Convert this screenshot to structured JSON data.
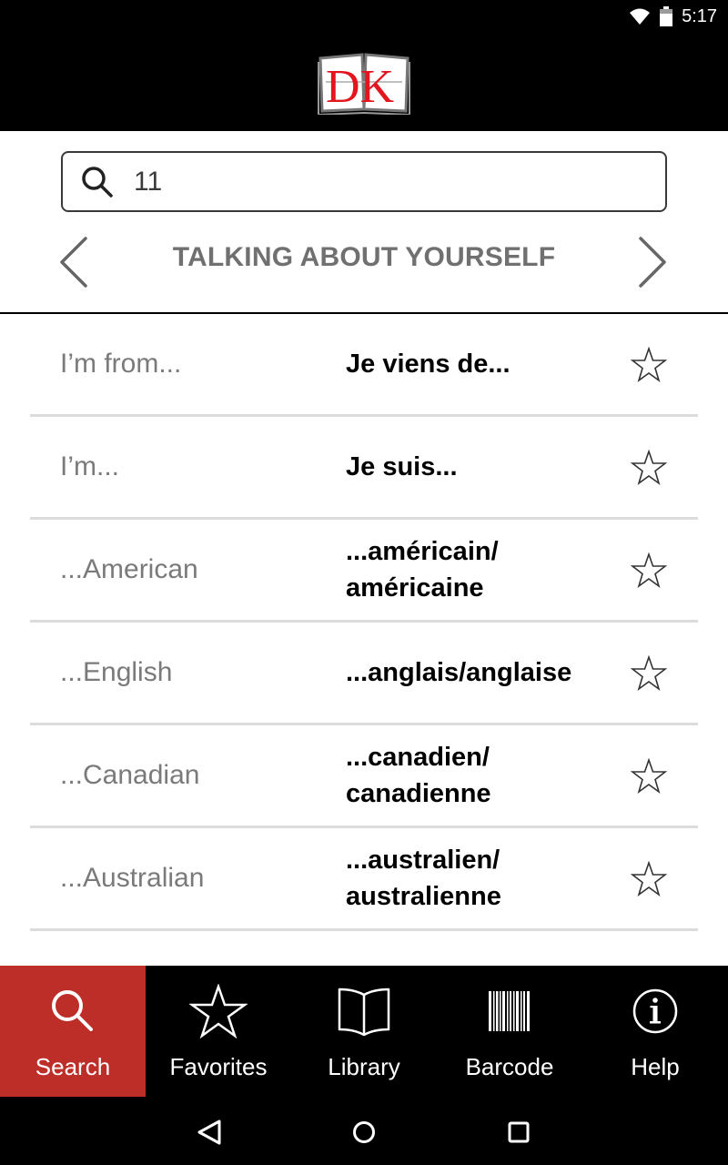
{
  "status_bar": {
    "time": "5:17",
    "icons": [
      "wifi-icon",
      "battery-icon"
    ]
  },
  "header": {
    "logo_text": "DK",
    "logo_colors": {
      "letters": "#e3161f",
      "book": "#ffffff",
      "outline": "#555555"
    }
  },
  "search": {
    "value": "11",
    "icon": "search-icon"
  },
  "category": {
    "title": "TALKING ABOUT YOURSELF",
    "prev_icon": "chevron-left-icon",
    "next_icon": "chevron-right-icon"
  },
  "phrases": [
    {
      "english": "I’m from...",
      "french": "Je viens de...",
      "favorite": false
    },
    {
      "english": "I’m...",
      "french": "Je suis...",
      "favorite": false
    },
    {
      "english": "...American",
      "french": "...américain/ américaine",
      "favorite": false
    },
    {
      "english": "...English",
      "french": "...anglais/anglaise",
      "favorite": false
    },
    {
      "english": "...Canadian",
      "french": "...canadien/ canadienne",
      "favorite": false
    },
    {
      "english": "...Australian",
      "french": "...australien/ australienne",
      "favorite": false
    }
  ],
  "bottom_nav": {
    "active_color": "#be2e29",
    "items": [
      {
        "label": "Search",
        "icon": "search-icon",
        "active": true
      },
      {
        "label": "Favorites",
        "icon": "star-icon",
        "active": false
      },
      {
        "label": "Library",
        "icon": "book-icon",
        "active": false
      },
      {
        "label": "Barcode",
        "icon": "barcode-icon",
        "active": false
      },
      {
        "label": "Help",
        "icon": "info-icon",
        "active": false
      }
    ]
  },
  "system_nav": {
    "buttons": [
      "back-icon",
      "home-icon",
      "recents-icon"
    ]
  }
}
